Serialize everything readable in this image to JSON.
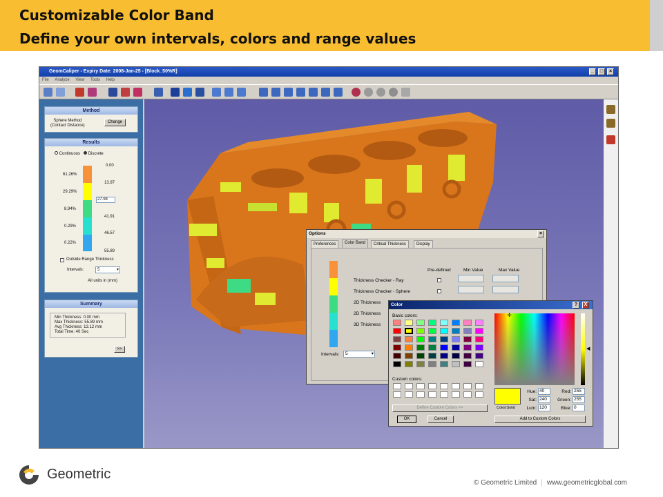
{
  "slide": {
    "title_line1": "Customizable Color Band",
    "title_line2": "Define your own intervals, colors and range values"
  },
  "app": {
    "title": "GeomCaliper - Expiry Date: 2008-Jan-25 - [Block_50%R]",
    "menu": [
      "File",
      "Analyze",
      "View",
      "Tools",
      "Help"
    ],
    "method": {
      "header": "Method",
      "text_line1": "Sphere Method",
      "text_line2": "(Contact Distance)",
      "change_label": "Change"
    },
    "results": {
      "header": "Results",
      "mode_continuous": "Continuous",
      "mode_discrete": "Discrete",
      "percentages": [
        "61.26%",
        "29.29%",
        "8.94%",
        "0.29%",
        "0.22%"
      ],
      "values": [
        "0.00",
        "13.97",
        "27.94",
        "41.91",
        "46.57",
        "55.89"
      ],
      "band_colors": [
        "#f7923a",
        "#ffff00",
        "#3ddc84",
        "#27e0d0",
        "#33a6f0"
      ],
      "outside_range_label": "Outside Range Thickness",
      "intervals_label": "Intervals:",
      "intervals_value": "5",
      "units_label": "All units in (mm)"
    },
    "summary": {
      "header": "Summary",
      "min": "Min Thickness:  0.00 mm",
      "max": "Max Thickness:  55.89 mm",
      "avg": "Avg Thickness:  13.12 mm",
      "time": "Total Time:        40 Sec",
      "more_label": ">>"
    }
  },
  "options_dialog": {
    "title": "Options",
    "tabs": [
      "Preferences",
      "Color Band",
      "Critical Thickness",
      "Display"
    ],
    "col_predefined": "Pre-defined",
    "col_min": "Min Value",
    "col_max": "Max Value",
    "rows": [
      "Thickness Checker - Ray",
      "Thickness Checker - Sphere",
      "2D Thickness",
      "2D Thickness",
      "3D Thickness"
    ],
    "intervals_label": "Intervals:",
    "intervals_value": "5",
    "band_colors": [
      "#f7923a",
      "#ffff00",
      "#3ddc84",
      "#27e0d0",
      "#33a6f0"
    ]
  },
  "color_dialog": {
    "title": "Color",
    "help_label": "?",
    "close_label": "X",
    "basic_colors_label": "Basic colors:",
    "custom_colors_label": "Custom colors:",
    "define_custom_label": "Define Custom Colors >>",
    "ok_label": "OK",
    "cancel_label": "Cancel",
    "hue_label": "Hue:",
    "hue": "40",
    "sat_label": "Sat:",
    "sat": "240",
    "lum_label": "Lum:",
    "lum": "120",
    "red_label": "Red:",
    "red": "255",
    "green_label": "Green:",
    "green": "255",
    "blue_label": "Blue:",
    "blue": "0",
    "color_solid_label": "Color|Solid",
    "add_custom_label": "Add to Custom Colors",
    "selected_color": "#ffff00",
    "basic_colors": [
      "#ff8080",
      "#ffff80",
      "#80ff80",
      "#00ff80",
      "#80ffff",
      "#0080ff",
      "#ff80c0",
      "#ff80ff",
      "#ff0000",
      "#ffff00",
      "#80ff00",
      "#00ff40",
      "#00ffff",
      "#0080c0",
      "#8080c0",
      "#ff00ff",
      "#804040",
      "#ff8040",
      "#00ff00",
      "#008080",
      "#004080",
      "#8080ff",
      "#800040",
      "#ff0080",
      "#800000",
      "#ff8000",
      "#008000",
      "#008040",
      "#0000ff",
      "#0000a0",
      "#800080",
      "#8000ff",
      "#400000",
      "#804000",
      "#004000",
      "#004040",
      "#000080",
      "#000040",
      "#400040",
      "#400080",
      "#000000",
      "#808000",
      "#808040",
      "#808080",
      "#408080",
      "#c0c0c0",
      "#400040",
      "#ffffff"
    ]
  },
  "footer": {
    "brand": "Geometric",
    "copyright": "© Geometric Limited",
    "separator": "|",
    "website": "www.geometricglobal.com"
  }
}
